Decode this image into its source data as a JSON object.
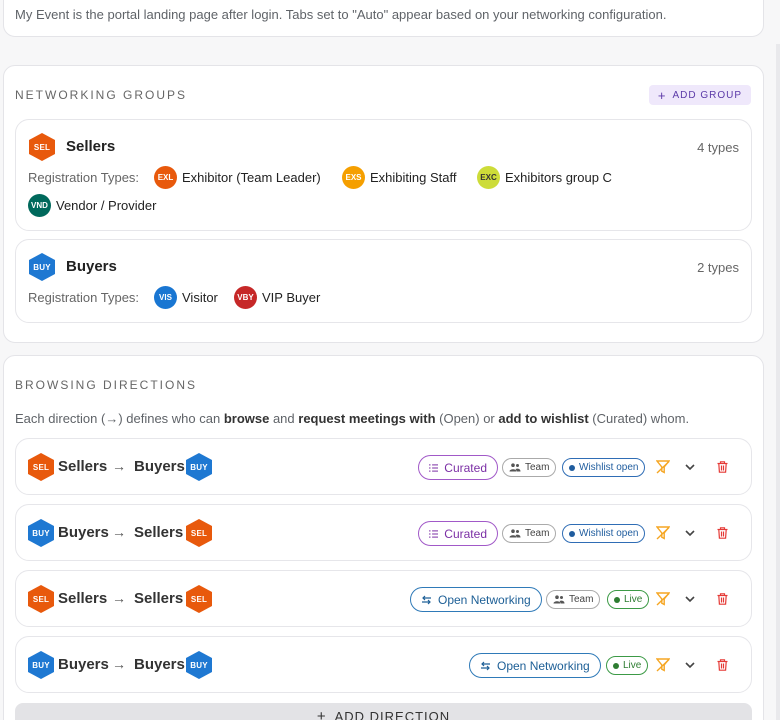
{
  "intro": {
    "text": "My Event is the portal landing page after login. Tabs set to \"Auto\" appear based on your networking configuration."
  },
  "networking_groups": {
    "title": "NETWORKING GROUPS",
    "add_button_label": "ADD GROUP",
    "reg_types_label": "Registration Types:",
    "groups": [
      {
        "badge": "SEL",
        "name": "Sellers",
        "count": "4 types",
        "types": [
          {
            "code": "EXL",
            "label": "Exhibitor (Team Leader)",
            "color": "#e8590c"
          },
          {
            "code": "EXS",
            "label": "Exhibiting Staff",
            "color": "#f59f00"
          },
          {
            "code": "EXC",
            "label": "Exhibitors group C",
            "color": "#cddc39"
          },
          {
            "code": "VND",
            "label": "Vendor / Provider",
            "color": "#00695c"
          }
        ]
      },
      {
        "badge": "BUY",
        "name": "Buyers",
        "count": "2 types",
        "types": [
          {
            "code": "VIS",
            "label": "Visitor",
            "color": "#1976d2"
          },
          {
            "code": "VBY",
            "label": "VIP Buyer",
            "color": "#c62828"
          }
        ]
      }
    ]
  },
  "browsing_directions": {
    "title": "BROWSING DIRECTIONS",
    "desc": {
      "p1": "Each direction (→) defines who can ",
      "b1": "browse",
      "p2": " and ",
      "b2": "request meetings with",
      "p3": " (Open) or ",
      "b3": "add to wishlist",
      "p4": " (Curated) whom."
    },
    "directions": [
      {
        "from_badge": "SEL",
        "from": "Sellers",
        "to": "Buyers",
        "to_badge": "BUY",
        "mode": "Curated",
        "team": "Team",
        "status": "Wishlist open"
      },
      {
        "from_badge": "BUY",
        "from": "Buyers",
        "to": "Sellers",
        "to_badge": "SEL",
        "mode": "Curated",
        "team": "Team",
        "status": "Wishlist open"
      },
      {
        "from_badge": "SEL",
        "from": "Sellers",
        "to": "Sellers",
        "to_badge": "SEL",
        "mode": "Open Networking",
        "team": "Team",
        "status": "Live"
      },
      {
        "from_badge": "BUY",
        "from": "Buyers",
        "to": "Buyers",
        "to_badge": "BUY",
        "mode": "Open Networking",
        "team": "",
        "status": "Live"
      }
    ],
    "arrow": "→",
    "add_button_label": "ADD DIRECTION"
  },
  "colors": {
    "sellers": "#e8590c",
    "buyers": "#1e78d2",
    "curated": "#7b2fa5",
    "open": "#1d5f96",
    "live": "#2e7d32",
    "delete": "#e53935",
    "filter": "#f5a623"
  }
}
